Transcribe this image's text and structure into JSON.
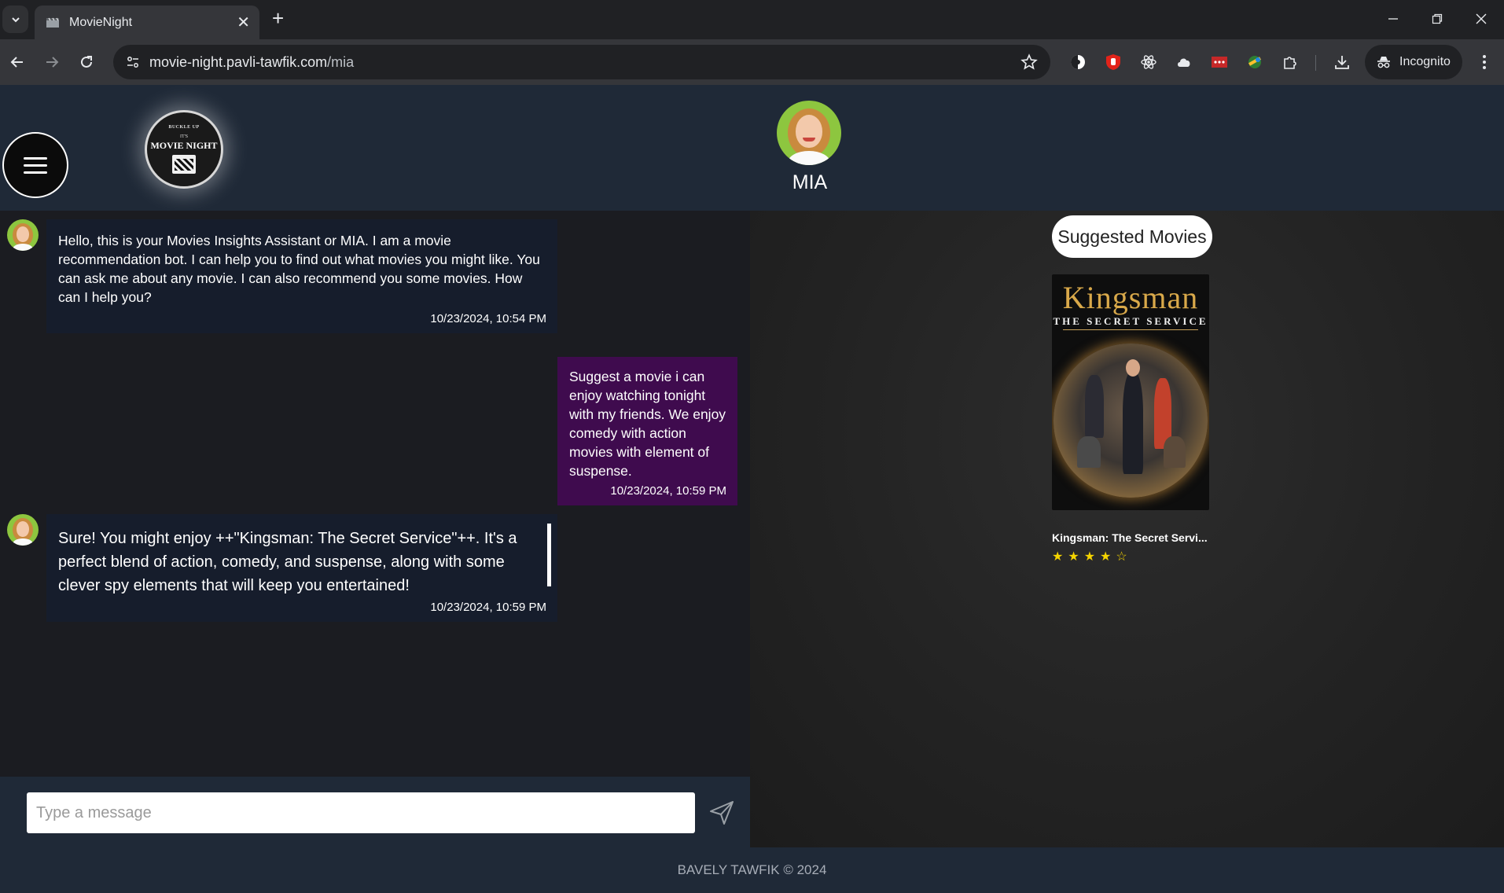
{
  "browser": {
    "tab_title": "MovieNight",
    "url_host": "movie-night.pavli-tawfik.com",
    "url_path": "/mia",
    "incognito_label": "Incognito",
    "extensions": [
      "theme-icon",
      "adblock-icon",
      "react-devtools-icon",
      "cloud-icon",
      "dots-extension-icon",
      "color-picker-icon",
      "puzzle-icon"
    ]
  },
  "app": {
    "logo": {
      "top_text": "BUCKLE UP",
      "its_text": "IT'S",
      "main_text": "MOVIE NIGHT"
    },
    "bot_name": "MIA"
  },
  "chat": {
    "messages": [
      {
        "sender": "bot",
        "text": "Hello, this is your Movies Insights Assistant or MIA. I am a movie recommendation bot. I can help you to find out what movies you might like. You can ask me about any movie. I can also recommend you some movies. How can I help you?",
        "time": "10/23/2024, 10:54 PM"
      },
      {
        "sender": "user",
        "text": "Suggest a movie i can enjoy watching tonight with my friends. We enjoy comedy with action movies with element of suspense.",
        "time": "10/23/2024, 10:59 PM"
      },
      {
        "sender": "bot",
        "text": "Sure! You might enjoy ++\"Kingsman: The Secret Service\"++. It's a perfect blend of action, comedy, and suspense, along with some clever spy elements that will keep you entertained!",
        "time": "10/23/2024, 10:59 PM"
      }
    ],
    "input": {
      "placeholder": "Type a message",
      "value": ""
    }
  },
  "suggestions": {
    "title": "Suggested Movies",
    "movies": [
      {
        "title": "Kingsman: The Secret Servi...",
        "poster_title": "Kingsman",
        "poster_subtitle": "THE SECRET SERVICE",
        "rating": 4,
        "max_rating": 5
      }
    ]
  },
  "footer": {
    "text": "BAVELY TAWFIK © 2024"
  },
  "colors": {
    "header_bg": "#1f2937",
    "chat_bg": "#1b1c21",
    "bot_bubble": "#161d2c",
    "user_bubble": "#3f0b4e",
    "avatar_bg": "#8dc63f",
    "star": "#f5d400"
  }
}
